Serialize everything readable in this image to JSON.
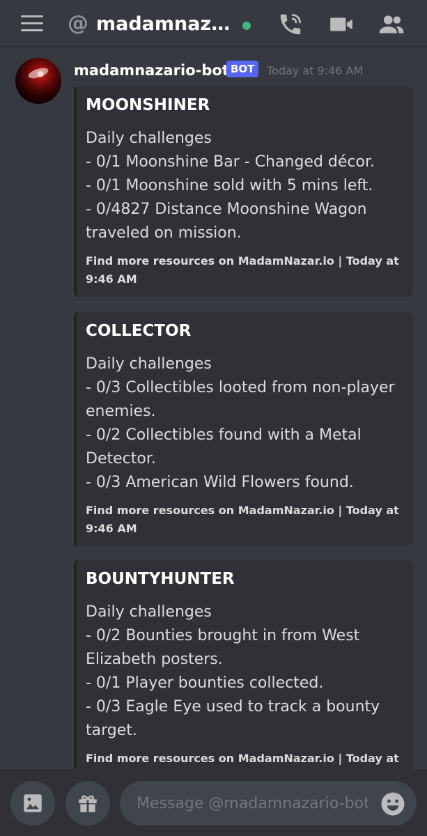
{
  "header": {
    "channel_name": "madamnazari...",
    "at_symbol": "@",
    "icons": [
      "menu-icon",
      "call-icon",
      "video-icon",
      "members-icon"
    ]
  },
  "message": {
    "author": "madamnazario-bot",
    "bot_tag": "BOT",
    "timestamp": "Today at 9:46 AM",
    "embeds": [
      {
        "title": "MOONSHINER",
        "lines": [
          "Daily challenges",
          "- 0/1 Moonshine Bar - Changed décor.",
          "- 0/1 Moonshine sold with 5 mins left.",
          "- 0/4827 Distance Moonshine Wagon traveled on mission."
        ],
        "footer": "Find more resources on MadamNazar.io | Today at 9:46 AM"
      },
      {
        "title": "COLLECTOR",
        "lines": [
          "Daily challenges",
          "- 0/3 Collectibles looted from non-player enemies.",
          "- 0/2 Collectibles found with a Metal Detector.",
          "- 0/3 American Wild Flowers found."
        ],
        "footer": "Find more resources on MadamNazar.io | Today at 9:46 AM"
      },
      {
        "title": "BOUNTYHUNTER",
        "lines": [
          "Daily challenges",
          "- 0/2 Bounties brought in from West Elizabeth posters.",
          "- 0/1 Player bounties collected.",
          "- 0/3 Eagle Eye used to track a bounty target."
        ],
        "footer": "Find more resources on MadamNazar.io | Today at"
      }
    ]
  },
  "composer": {
    "placeholder": "Message @madamnazario-bot"
  },
  "colors": {
    "background": "#36393f",
    "embed_bg": "#2f3136",
    "bot_tag": "#5865f2",
    "online": "#43b581"
  }
}
